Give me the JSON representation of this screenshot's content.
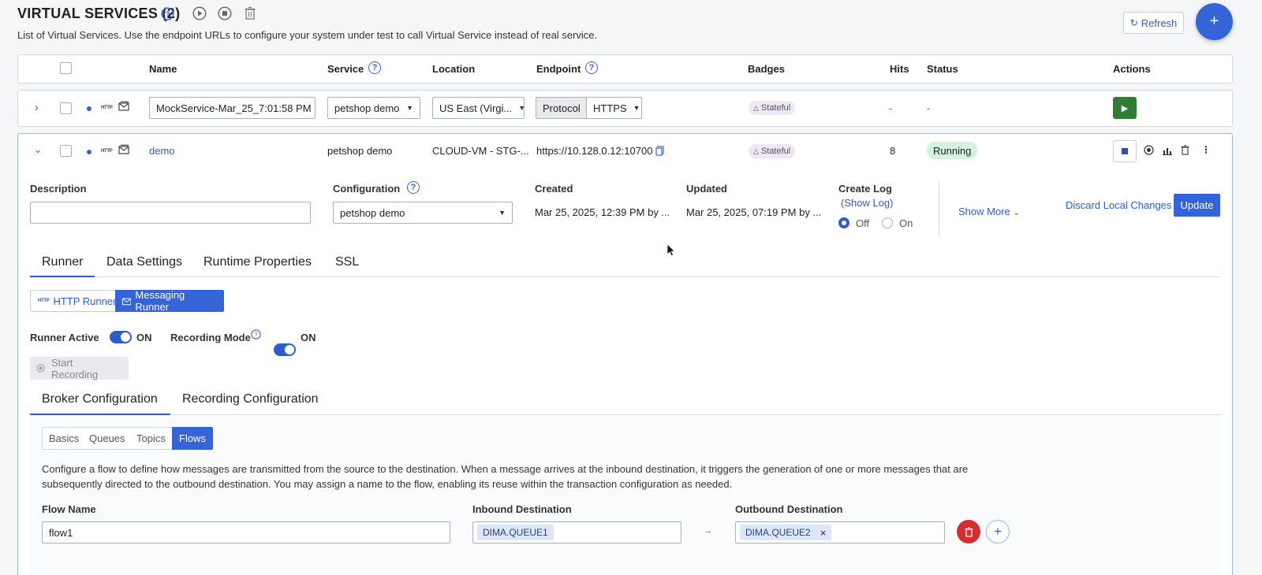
{
  "header": {
    "title": "VIRTUAL SERVICES (2)",
    "subtitle": "List of Virtual Services. Use the endpoint URLs to configure your system under test to call Virtual Service instead of real service.",
    "refresh_label": "Refresh",
    "add_label": "+"
  },
  "table": {
    "columns": {
      "name": "Name",
      "service": "Service",
      "location": "Location",
      "endpoint": "Endpoint",
      "badges": "Badges",
      "hits": "Hits",
      "status": "Status",
      "actions": "Actions"
    }
  },
  "rows": [
    {
      "name": "MockService-Mar_25_7:01:58 PM",
      "service": "petshop demo",
      "location": "US East (Virgi...",
      "protocol_label": "Protocol",
      "protocol": "HTTPS",
      "badge": "Stateful",
      "hits": "-",
      "status": "-"
    },
    {
      "name": "demo",
      "service": "petshop demo",
      "location": "CLOUD-VM - STG-...",
      "endpoint": "https://10.128.0.12:10700",
      "badge": "Stateful",
      "hits": "8",
      "status": "Running"
    }
  ],
  "detail": {
    "description_label": "Description",
    "description_value": "",
    "configuration_label": "Configuration",
    "configuration_value": "petshop demo",
    "created_label": "Created",
    "created_value": "Mar 25, 2025, 12:39 PM by ...",
    "updated_label": "Updated",
    "updated_value": "Mar 25, 2025, 07:19 PM by ...",
    "create_log_label": "Create Log",
    "show_log": "(Show Log)",
    "off_label": "Off",
    "on_label": "On",
    "show_more": "Show More",
    "discard": "Discard Local Changes",
    "update": "Update"
  },
  "tabs": [
    "Runner",
    "Data Settings",
    "Runtime Properties",
    "SSL"
  ],
  "runner": {
    "http_runner": "HTTP Runner",
    "messaging_runner": "Messaging Runner",
    "runner_active_label": "Runner Active",
    "runner_active_state": "ON",
    "recording_mode_label": "Recording Mode",
    "recording_mode_state": "ON",
    "start_recording": "Start Recording"
  },
  "config_tabs": [
    "Broker Configuration",
    "Recording Configuration"
  ],
  "broker_tabs": [
    "Basics",
    "Queues",
    "Topics",
    "Flows"
  ],
  "flows": {
    "description_line1": "Configure a flow to define how messages are transmitted from the source to the destination. When a message arrives at the inbound destination, it triggers the generation of one or more messages that are",
    "description_line2": "subsequently directed to the outbound destination. You may assign a name to the flow, enabling its reuse within the transaction configuration as needed.",
    "flow_name_label": "Flow Name",
    "flow_name_value": "flow1",
    "inbound_label": "Inbound Destination",
    "inbound_value": "DIMA.QUEUE1",
    "arrow": "→",
    "outbound_label": "Outbound Destination",
    "outbound_value": "DIMA.QUEUE2",
    "remove_chip": "×"
  }
}
